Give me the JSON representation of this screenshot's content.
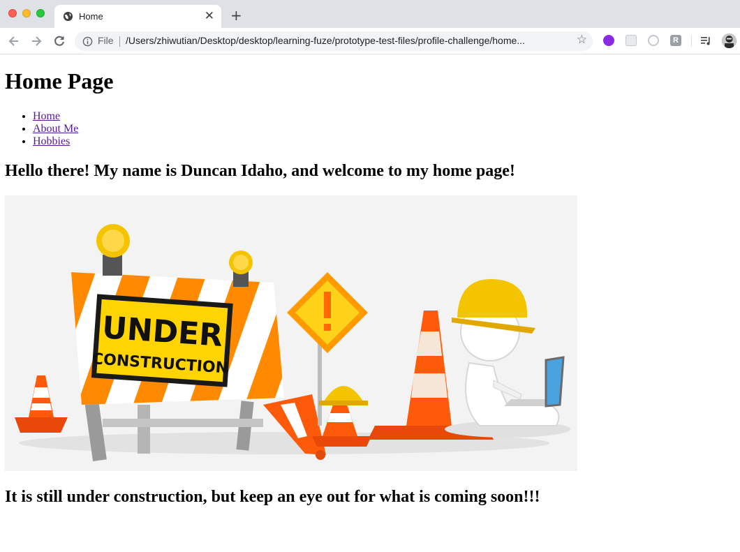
{
  "browser": {
    "tab_title": "Home",
    "file_label": "File",
    "url": "/Users/zhiwutian/Desktop/desktop/learning-fuze/prototype-test-files/profile-challenge/home...",
    "ext4_letter": "R"
  },
  "page": {
    "heading": "Home Page",
    "nav": [
      {
        "label": "Home"
      },
      {
        "label": "About Me"
      },
      {
        "label": "Hobbies"
      }
    ],
    "greeting": "Hello there! My name is Duncan Idaho, and welcome to my home page!",
    "sign_line1": "UNDER",
    "sign_line2": "CONSTRUCTION",
    "footer_text": "It is still under construction, but keep an eye out for what is coming soon!!!"
  },
  "colors": {
    "link": "#551a8b",
    "sign_yellow": "#ffd400",
    "cone_orange": "#ff5a0a"
  }
}
